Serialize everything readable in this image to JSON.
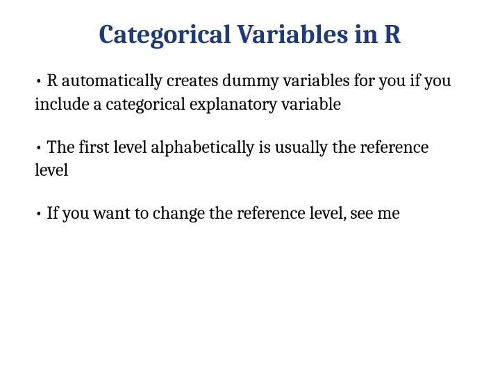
{
  "title": "Categorical Variables in R",
  "bullets": [
    "R automatically creates dummy variables for you if you include a categorical explanatory variable",
    "The first level alphabetically is usually the reference level",
    "If you want to change the reference level, see me"
  ],
  "bullet_char": "•"
}
